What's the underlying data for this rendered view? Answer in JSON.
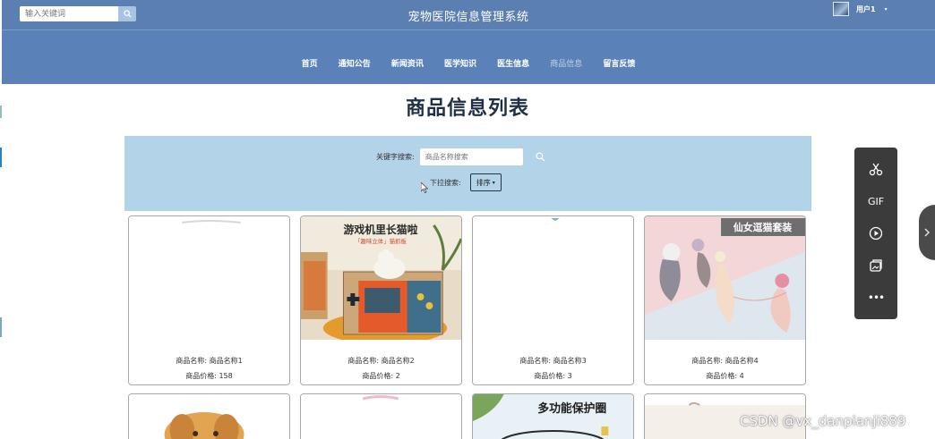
{
  "header": {
    "search_placeholder": "输入关键词",
    "site_title": "宠物医院信息管理系统",
    "user_name": "用户1",
    "user_caret": "▾"
  },
  "nav": {
    "items": [
      {
        "label": "首页"
      },
      {
        "label": "通知公告"
      },
      {
        "label": "新闻资讯"
      },
      {
        "label": "医学知识"
      },
      {
        "label": "医生信息"
      },
      {
        "label": "商品信息",
        "active": true
      },
      {
        "label": "留言反馈"
      }
    ]
  },
  "page": {
    "heading": "商品信息列表"
  },
  "filter": {
    "keyword_label": "关键字搜索:",
    "keyword_placeholder": "商品名称搜索",
    "dropdown_label": "下拉搜索:",
    "sort_label": "排序",
    "sort_caret": "▾"
  },
  "products": [
    {
      "name": "商品名称: 商品名称1",
      "price": "商品价格: 158"
    },
    {
      "name": "商品名称: 商品名称2",
      "price": "商品价格: 2",
      "image_text_1": "游戏机里长猫啦",
      "image_text_2": "「趣味立体」猫抓板"
    },
    {
      "name": "商品名称: 商品名称3",
      "price": "商品价格: 3"
    },
    {
      "name": "商品名称: 商品名称4",
      "price": "商品价格: 4",
      "image_text_1": "仙女逗猫套装"
    }
  ],
  "products_row2": [
    {
      "image_text_1": ""
    },
    {
      "image_text_1": ""
    },
    {
      "image_text_1": "多功能保护圈"
    },
    {
      "image_text_1": ""
    }
  ],
  "toolbar": {
    "tools": [
      {
        "icon": "scissors-icon"
      },
      {
        "label": "GIF"
      },
      {
        "icon": "record-icon"
      },
      {
        "icon": "screenshot-icon"
      },
      {
        "label": "•••"
      }
    ]
  },
  "watermark": "CSDN @vx_danpianji889",
  "colors": {
    "topbar": "#5b7fb1",
    "navbar": "#5a82b8",
    "filter_panel": "#b3d3e8",
    "heading": "#1f2f46"
  }
}
